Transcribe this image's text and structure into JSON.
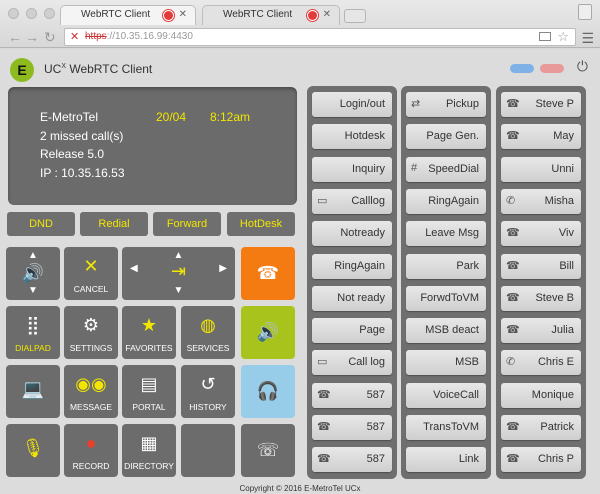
{
  "browser": {
    "tabs": [
      {
        "title": "WebRTC Client"
      },
      {
        "title": "WebRTC Client"
      }
    ],
    "url": "https://10.35.16.99:4430",
    "url_scheme": "https",
    "url_rest": "://10.35.16.99:4430"
  },
  "app": {
    "logo_letter": "E",
    "title": "UC",
    "title_sup": "X",
    "title_rest": " WebRTC Client",
    "status_pill_colors": [
      "#7fb0e6",
      "#e89a9a"
    ]
  },
  "display": {
    "name": "E-MetroTel",
    "date": "20/04",
    "time": "8:12am",
    "missed": "2 missed call(s)",
    "release": "Release 5.0",
    "ip": "IP : 10.35.16.53"
  },
  "feature_keys": [
    "DND",
    "Redial",
    "Forward",
    "HotDesk"
  ],
  "keys": {
    "cancel": "CANCEL",
    "dialpad": "DIALPAD",
    "settings": "SETTINGS",
    "favorites": "FAVORITES",
    "services": "SERVICES",
    "message": "MESSAGE",
    "portal": "PORTAL",
    "history": "HISTORY",
    "record": "RECORD",
    "directory": "DIRECTORY"
  },
  "column1": [
    {
      "label": "Login/out",
      "icon": ""
    },
    {
      "label": "Hotdesk",
      "icon": ""
    },
    {
      "label": "Inquiry",
      "icon": ""
    },
    {
      "label": "Calllog",
      "icon": "calllog-icon"
    },
    {
      "label": "Notready",
      "icon": ""
    },
    {
      "label": "RingAgain",
      "icon": ""
    },
    {
      "label": "Not ready",
      "icon": ""
    },
    {
      "label": "Page",
      "icon": ""
    },
    {
      "label": "Call log",
      "icon": "calllog-icon"
    },
    {
      "label": "587",
      "icon": "phone-icon"
    },
    {
      "label": "587",
      "icon": "phone-icon"
    },
    {
      "label": "587",
      "icon": "phone-icon"
    }
  ],
  "column2": [
    {
      "label": "Pickup",
      "icon": "pickup-icon"
    },
    {
      "label": "Page Gen.",
      "icon": ""
    },
    {
      "label": "SpeedDial",
      "icon": "hash-icon"
    },
    {
      "label": "RingAgain",
      "icon": ""
    },
    {
      "label": "Leave Msg",
      "icon": ""
    },
    {
      "label": "Park",
      "icon": ""
    },
    {
      "label": "ForwdToVM",
      "icon": ""
    },
    {
      "label": "MSB deact",
      "icon": ""
    },
    {
      "label": "MSB",
      "icon": ""
    },
    {
      "label": "VoiceCall",
      "icon": ""
    },
    {
      "label": "TransToVM",
      "icon": ""
    },
    {
      "label": "Link",
      "icon": ""
    }
  ],
  "column3": [
    {
      "label": "Steve P",
      "icon": "phone-icon"
    },
    {
      "label": "May",
      "icon": "phone-icon"
    },
    {
      "label": "Unni",
      "icon": ""
    },
    {
      "label": "Misha",
      "icon": "handset-icon"
    },
    {
      "label": "Viv",
      "icon": "phone-icon"
    },
    {
      "label": "Bill",
      "icon": "phone-icon"
    },
    {
      "label": "Steve B",
      "icon": "phone-icon"
    },
    {
      "label": "Julia",
      "icon": "phone-icon"
    },
    {
      "label": "Chris E",
      "icon": "handset-icon"
    },
    {
      "label": "Monique",
      "icon": ""
    },
    {
      "label": "Patrick",
      "icon": "phone-icon"
    },
    {
      "label": "Chris P",
      "icon": "phone-icon"
    }
  ],
  "footer": {
    "copyright": "Copyright © 2016 E-MetroTel UCx"
  }
}
